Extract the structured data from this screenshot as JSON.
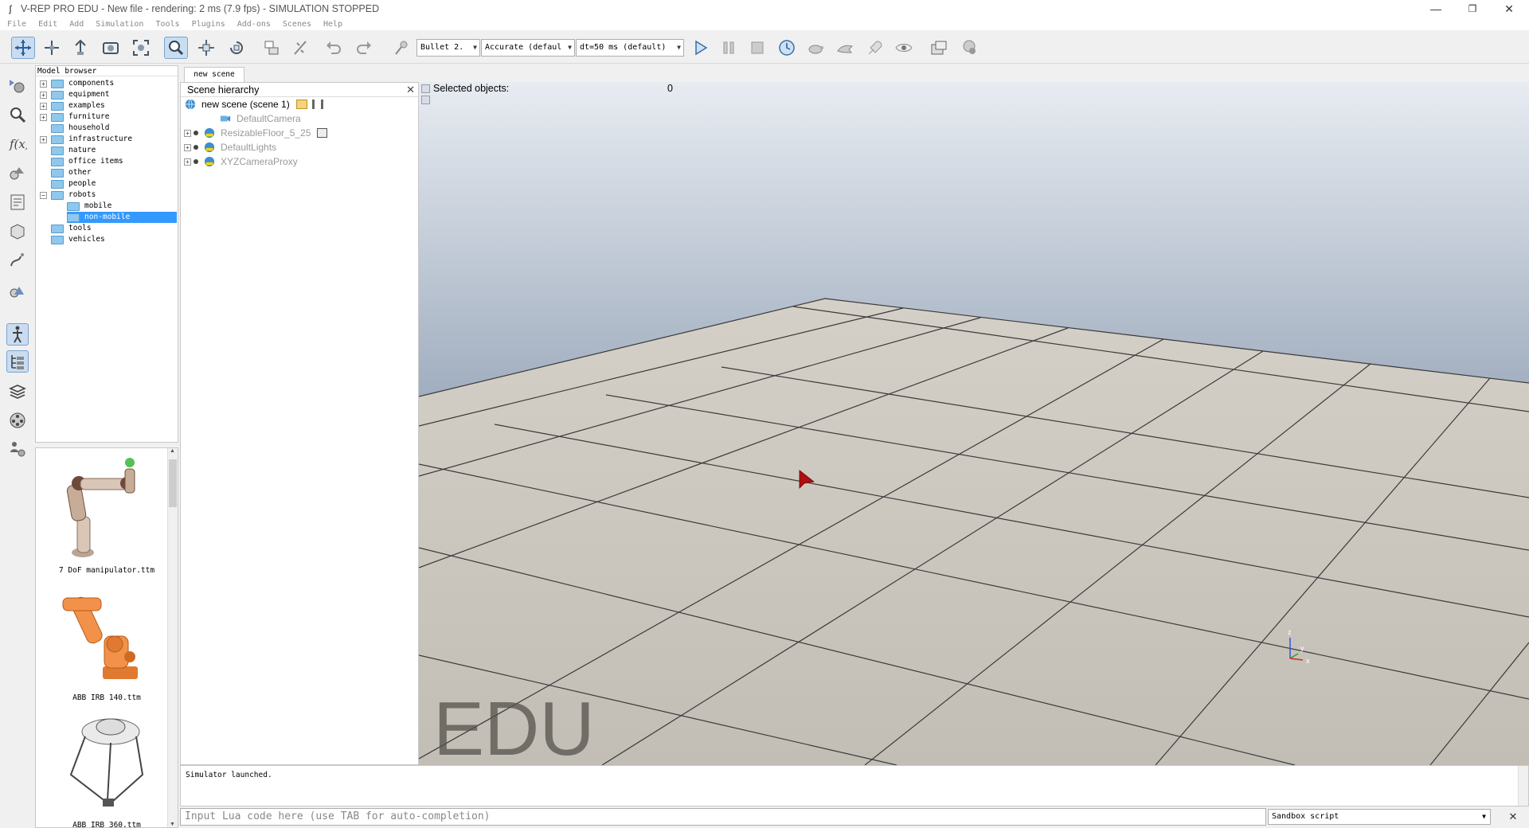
{
  "window": {
    "title": "V-REP PRO EDU - New file - rendering: 2 ms (7.9 fps) - SIMULATION STOPPED",
    "app_icon": "ʃ",
    "minimize": "—",
    "maximize": "❐",
    "close": "✕"
  },
  "menu": [
    "File",
    "Edit",
    "Add",
    "Simulation",
    "Tools",
    "Plugins",
    "Add-ons",
    "Scenes",
    "Help"
  ],
  "toolbar": {
    "physics_engine": "Bullet 2.",
    "accuracy": "Accurate (defaul",
    "timestep": "dt=50 ms (default)",
    "icons": [
      "pan-icon",
      "translate-icon",
      "rotate-icon",
      "fit-view-icon",
      "zoom-fit-icon",
      "click-select-icon",
      "object-shift-icon",
      "object-rotate-icon",
      "assemble-icon",
      "transfer-dna-icon",
      "undo-icon",
      "redo-icon",
      "pick-icon",
      "play-icon",
      "pause-icon",
      "stop-icon",
      "realtime-icon",
      "slow-icon",
      "fast-icon",
      "thread-icon",
      "visualization-icon",
      "scene-page-icon",
      "settings-icon"
    ]
  },
  "model_browser": {
    "header": "Model browser",
    "items": [
      {
        "label": "components",
        "expandable": true
      },
      {
        "label": "equipment",
        "expandable": true
      },
      {
        "label": "examples",
        "expandable": true
      },
      {
        "label": "furniture",
        "expandable": true
      },
      {
        "label": "household",
        "expandable": false
      },
      {
        "label": "infrastructure",
        "expandable": true
      },
      {
        "label": "nature",
        "expandable": false
      },
      {
        "label": "office items",
        "expandable": false
      },
      {
        "label": "other",
        "expandable": false
      },
      {
        "label": "people",
        "expandable": false
      },
      {
        "label": "robots",
        "expandable": true,
        "expanded": true
      },
      {
        "label": "mobile",
        "expandable": false,
        "child": true
      },
      {
        "label": "non-mobile",
        "expandable": false,
        "child": true,
        "selected": true
      },
      {
        "label": "tools",
        "expandable": false
      },
      {
        "label": "vehicles",
        "expandable": false
      }
    ],
    "thumbnails": [
      "7 DoF manipulator.ttm",
      "ABB IRB 140.ttm",
      "ABB IRB 360.ttm"
    ]
  },
  "scene_tab": "new scene",
  "scene_hierarchy": {
    "header": "Scene hierarchy",
    "root": "new scene (scene 1)",
    "objects": [
      "DefaultCamera",
      "ResizableFloor_5_25",
      "DefaultLights",
      "XYZCameraProxy"
    ]
  },
  "viewport": {
    "selected_label": "Selected objects:",
    "selected_count": "0",
    "watermark": "EDU",
    "axis_z": "z",
    "axis_y": "y",
    "axis_x": "x"
  },
  "console": {
    "message": "Simulator launched."
  },
  "lua_input": {
    "placeholder": "Input Lua code here (use TAB for auto-completion)"
  },
  "script_selector": {
    "value": "Sandbox script"
  },
  "colors": {
    "selection": "#3399ff",
    "sky_top": "#e8ecf2",
    "sky_bottom": "#7a889c",
    "floor": "#c9c5bc",
    "grid": "#3a3a3a"
  }
}
